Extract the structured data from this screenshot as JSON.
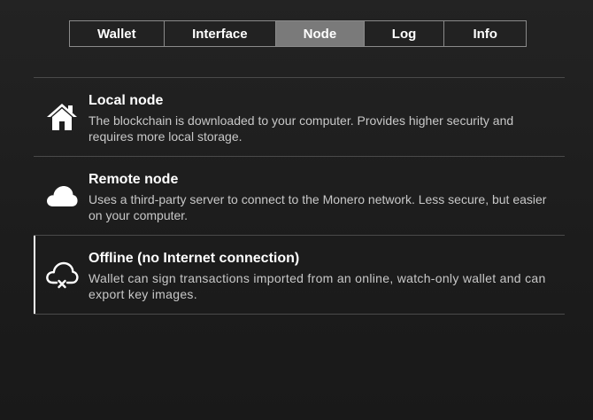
{
  "tabs": [
    {
      "label": "Wallet"
    },
    {
      "label": "Interface"
    },
    {
      "label": "Node",
      "active": true
    },
    {
      "label": "Log"
    },
    {
      "label": "Info"
    }
  ],
  "node_options": [
    {
      "title": "Local node",
      "description": "The blockchain is downloaded to your computer. Provides higher security and requires more local storage.",
      "icon": "home-icon"
    },
    {
      "title": "Remote node",
      "description": "Uses a third-party server to connect to the Monero network. Less secure, but easier on your computer.",
      "icon": "cloud-icon"
    },
    {
      "title": "Offline (no Internet connection)",
      "description": "Wallet can sign transactions imported from an online, watch-only wallet and can export key images.",
      "icon": "cloud-offline-icon",
      "selected": true
    }
  ],
  "colors": {
    "active_tab": "#7a7a7a",
    "text": "#ffffff",
    "secondary_text": "#c8c8c8",
    "divider": "#4a4a4a"
  }
}
